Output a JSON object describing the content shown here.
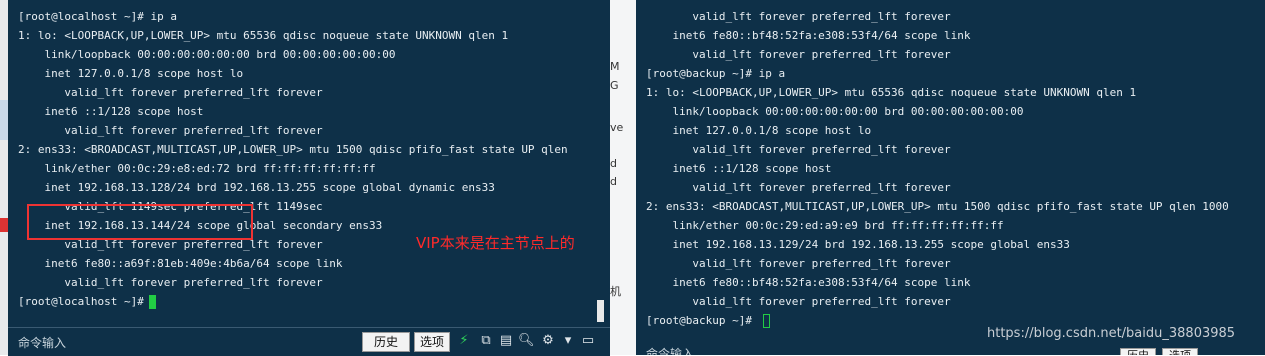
{
  "left_terminal": {
    "lines": [
      "[root@localhost ~]# ip a",
      "1: lo: <LOOPBACK,UP,LOWER_UP> mtu 65536 qdisc noqueue state UNKNOWN qlen 1",
      "    link/loopback 00:00:00:00:00:00 brd 00:00:00:00:00:00",
      "    inet 127.0.0.1/8 scope host lo",
      "       valid_lft forever preferred_lft forever",
      "    inet6 ::1/128 scope host",
      "       valid_lft forever preferred_lft forever",
      "2: ens33: <BROADCAST,MULTICAST,UP,LOWER_UP> mtu 1500 qdisc pfifo_fast state UP qlen",
      "    link/ether 00:0c:29:e8:ed:72 brd ff:ff:ff:ff:ff:ff",
      "    inet 192.168.13.128/24 brd 192.168.13.255 scope global dynamic ens33",
      "       valid_lft 1149sec preferred_lft 1149sec",
      "    inet 192.168.13.144/24 scope global secondary ens33",
      "       valid_lft forever preferred_lft forever",
      "    inet6 fe80::a69f:81eb:409e:4b6a/64 scope link",
      "       valid_lft forever preferred_lft forever",
      "[root@localhost ~]# "
    ],
    "command_bar": {
      "label": "命令输入",
      "history_button": "历史",
      "options_button": "选项"
    }
  },
  "right_terminal": {
    "lines": [
      "       valid_lft forever preferred_lft forever",
      "    inet6 fe80::bf48:52fa:e308:53f4/64 scope link",
      "       valid_lft forever preferred_lft forever",
      "[root@backup ~]# ip a",
      "1: lo: <LOOPBACK,UP,LOWER_UP> mtu 65536 qdisc noqueue state UNKNOWN qlen 1",
      "    link/loopback 00:00:00:00:00:00 brd 00:00:00:00:00:00",
      "    inet 127.0.0.1/8 scope host lo",
      "       valid_lft forever preferred_lft forever",
      "    inet6 ::1/128 scope host",
      "       valid_lft forever preferred_lft forever",
      "2: ens33: <BROADCAST,MULTICAST,UP,LOWER_UP> mtu 1500 qdisc pfifo_fast state UP qlen 1000",
      "    link/ether 00:0c:29:ed:a9:e9 brd ff:ff:ff:ff:ff:ff",
      "    inet 192.168.13.129/24 brd 192.168.13.255 scope global ens33",
      "       valid_lft forever preferred_lft forever",
      "    inet6 fe80::bf48:52fa:e308:53f4/64 scope link",
      "       valid_lft forever preferred_lft forever",
      "[root@backup ~]# "
    ],
    "command_bar": {
      "label": "命令输入",
      "history_button": "历史",
      "options_button": "选项"
    }
  },
  "middle_strip": [
    "M",
    "G",
    "ve",
    "d",
    "d",
    "机"
  ],
  "annotation": "VIP本来是在主节点上的",
  "watermark": "https://blog.csdn.net/baidu_38803985",
  "colors": {
    "terminal_bg": "#0e3048",
    "terminal_text": "#e8eef2",
    "cursor": "#22cc44",
    "annotation": "#ff2a2a"
  },
  "icons": [
    "lightning-icon",
    "copy-icon",
    "paste-icon",
    "search-icon",
    "gear-icon",
    "chevron-down-icon",
    "window-icon"
  ]
}
